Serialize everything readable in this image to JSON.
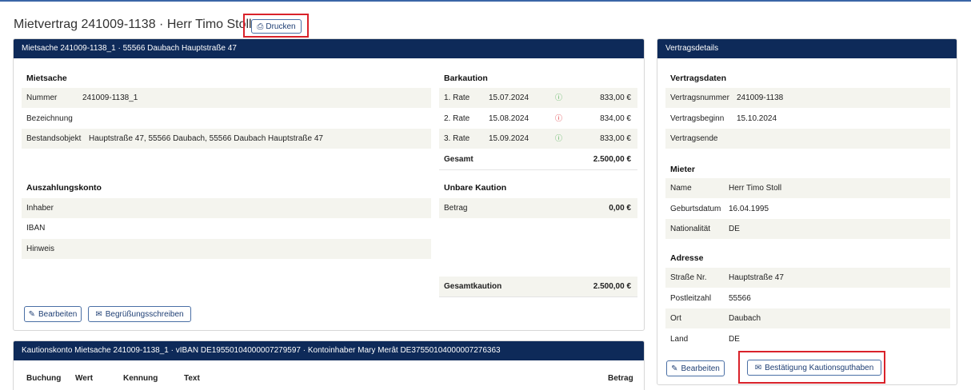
{
  "header": {
    "title": "Mietvertrag 241009-1138 · Herr Timo Stoll",
    "print_label": "Drucken"
  },
  "mietsache_panel": {
    "heading": "Mietsache 241009-1138_1 · 55566 Daubach Hauptstraße 47",
    "mietsache": {
      "title": "Mietsache",
      "rows": [
        {
          "label": "Nummer",
          "value": "241009-1138_1"
        },
        {
          "label": "Bezeichnung",
          "value": ""
        },
        {
          "label": "Bestandsobjekt",
          "value": "Hauptstraße 47, 55566 Daubach, 55566 Daubach Hauptstraße 47"
        }
      ]
    },
    "barkaution": {
      "title": "Barkaution",
      "rates": [
        {
          "label": "1. Rate",
          "date": "15.07.2024",
          "status": "ok",
          "amount": "833,00 €"
        },
        {
          "label": "2. Rate",
          "date": "15.08.2024",
          "status": "warn",
          "amount": "834,00 €"
        },
        {
          "label": "3. Rate",
          "date": "15.09.2024",
          "status": "ok",
          "amount": "833,00 €"
        }
      ],
      "total_label": "Gesamt",
      "total_value": "2.500,00 €"
    },
    "auszahlungskonto": {
      "title": "Auszahlungskonto",
      "rows": [
        {
          "label": "Inhaber"
        },
        {
          "label": "IBAN"
        },
        {
          "label": "Hinweis"
        }
      ]
    },
    "unbare_kaution": {
      "title": "Unbare Kaution",
      "betrag_label": "Betrag",
      "betrag_value": "0,00 €"
    },
    "gesamtkaution_label": "Gesamtkaution",
    "gesamtkaution_value": "2.500,00 €",
    "edit_label": "Bearbeiten",
    "welcome_label": "Begrüßungsschreiben"
  },
  "kautionskonto_panel": {
    "heading": "Kautionskonto Mietsache 241009-1138_1 · vIBAN DE19550104000007279597 · Kontoinhaber Mary Merât DE37550104000007276363",
    "columns": [
      "Buchung",
      "Wert",
      "Kennung",
      "Text",
      "Betrag"
    ]
  },
  "vertrag_panel": {
    "heading": "Vertragsdetails",
    "vertragsdaten": {
      "title": "Vertragsdaten",
      "rows": [
        {
          "label": "Vertragsnummer",
          "value": "241009-1138"
        },
        {
          "label": "Vertragsbeginn",
          "value": "15.10.2024"
        },
        {
          "label": "Vertragsende",
          "value": ""
        }
      ]
    },
    "mieter": {
      "title": "Mieter",
      "rows": [
        {
          "label": "Name",
          "value": "Herr Timo Stoll"
        },
        {
          "label": "Geburtsdatum",
          "value": "16.04.1995"
        },
        {
          "label": "Nationalität",
          "value": "DE"
        }
      ]
    },
    "adresse": {
      "title": "Adresse",
      "rows": [
        {
          "label": "Straße Nr.",
          "value": "Hauptstraße 47"
        },
        {
          "label": "Postleitzahl",
          "value": "55566"
        },
        {
          "label": "Ort",
          "value": "Daubach"
        },
        {
          "label": "Land",
          "value": "DE"
        }
      ]
    },
    "edit_label": "Bearbeiten",
    "confirm_label": "Bestätigung Kautionsguthaben"
  },
  "colors": {
    "panel_header": "#0e2a59",
    "highlight_box": "#d9222a",
    "row_shade": "#f4f4ee",
    "status_ok": "#4caf50",
    "status_warn": "#d9222a"
  },
  "icons": {
    "print": "printer-icon",
    "edit": "pencil-icon",
    "mail": "envelope-icon",
    "info": "info-circle-icon"
  }
}
